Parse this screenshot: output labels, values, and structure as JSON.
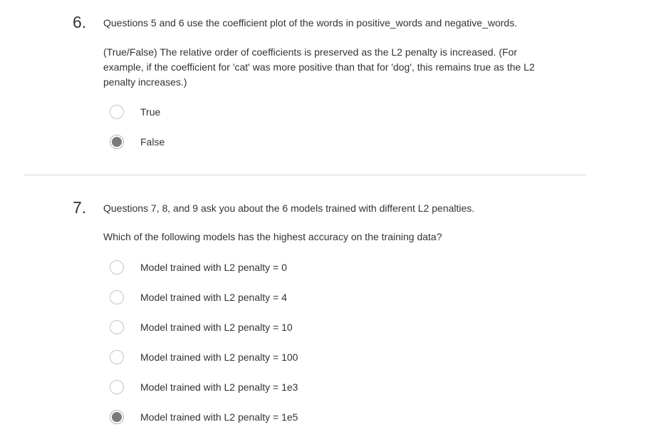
{
  "q6": {
    "number": "6.",
    "intro": "Questions 5 and 6 use the coefficient plot of the words in positive_words and negative_words.",
    "prompt": "(True/False) The relative order of coefficients is preserved as the L2 penalty is increased. (For example, if the coefficient for 'cat' was more positive than that for 'dog', this remains true as the L2 penalty increases.)",
    "options": [
      {
        "label": "True",
        "selected": false
      },
      {
        "label": "False",
        "selected": true
      }
    ]
  },
  "q7": {
    "number": "7.",
    "intro": "Questions 7, 8, and 9 ask you about the 6 models trained with different L2 penalties.",
    "prompt": "Which of the following models has the highest accuracy on the training data?",
    "options": [
      {
        "label": "Model trained with L2 penalty = 0",
        "selected": false
      },
      {
        "label": "Model trained with L2 penalty = 4",
        "selected": false
      },
      {
        "label": "Model trained with L2 penalty = 10",
        "selected": false
      },
      {
        "label": "Model trained with L2 penalty = 100",
        "selected": false
      },
      {
        "label": "Model trained with L2 penalty = 1e3",
        "selected": false
      },
      {
        "label": "Model trained with L2 penalty = 1e5",
        "selected": true
      }
    ]
  }
}
